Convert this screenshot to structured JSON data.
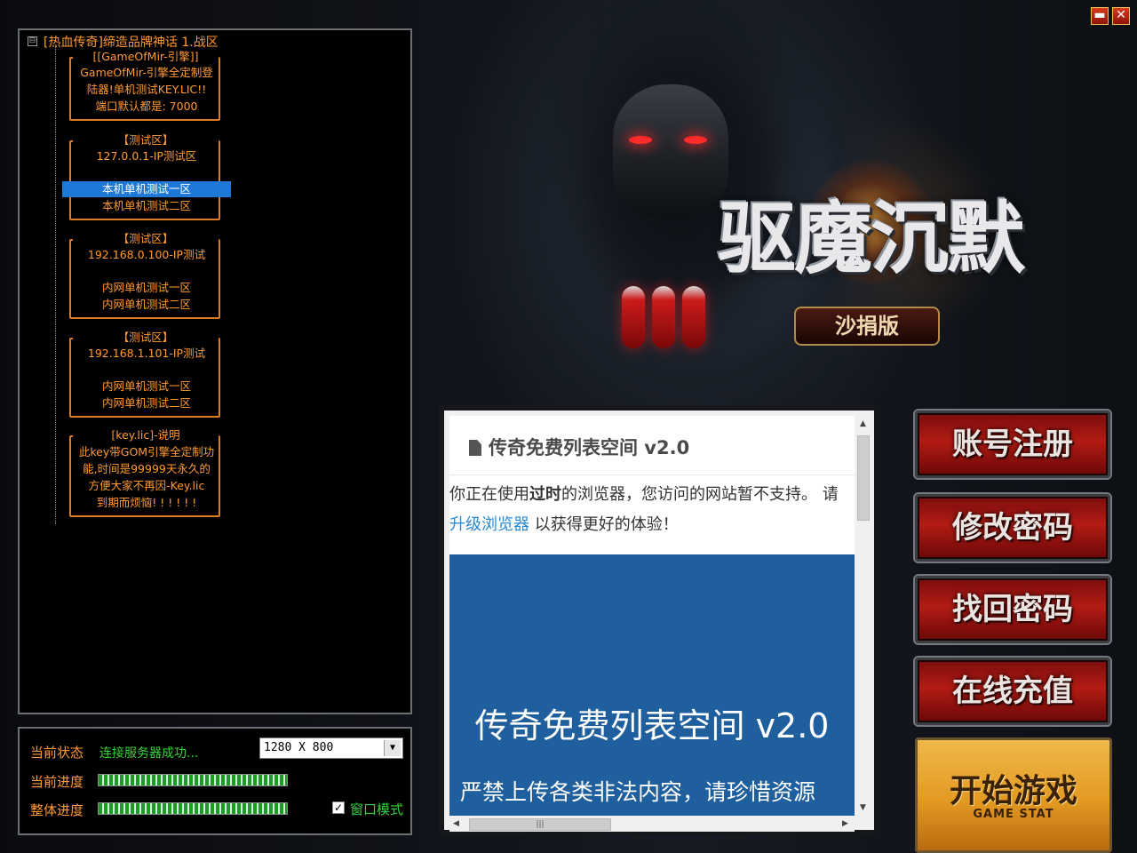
{
  "window": {
    "minimize_label": "▬",
    "close_label": "✕"
  },
  "logo": {
    "title": "驱魔沉默",
    "subtitle": "沙捐版"
  },
  "tree": {
    "expander": "⊟",
    "root_label": "[热血传奇]缔造品牌神话 1.战区",
    "groups": [
      {
        "title": "[[GameOfMir-引擎]]",
        "lines": [
          "GameOfMir-引擎全定制登",
          "陆器!单机测试KEY.LIC!!",
          "端口默认都是: 7000"
        ]
      },
      {
        "title": "【测试区】",
        "lines": [
          "127.0.0.1-IP测试区",
          "本机单机测试一区",
          "本机单机测试二区"
        ]
      },
      {
        "title": "【测试区】",
        "lines": [
          "192.168.0.100-IP测试",
          "内网单机测试一区",
          "内网单机测试二区"
        ]
      },
      {
        "title": "【测试区】",
        "lines": [
          "192.168.1.101-IP测试",
          "内网单机测试一区",
          "内网单机测试二区"
        ]
      },
      {
        "title": "[key.lic]-说明",
        "lines": [
          "此key带GOM引擎全定制功",
          "能,时间是99999天永久的",
          "方便大家不再因-Key.lic",
          "到期而烦恼! ! ! ! ! !"
        ]
      }
    ]
  },
  "status": {
    "state_label": "当前状态",
    "state_value": "连接服务器成功...",
    "current_progress_label": "当前进度",
    "current_progress": 1.0,
    "total_progress_label": "整体进度",
    "total_progress": 1.0,
    "resolution": "1280 X 800",
    "window_mode_label": "窗口模式",
    "window_mode_checked": true
  },
  "browser": {
    "header": "传奇免费列表空间 v2.0",
    "warn_prefix": "你正在使用",
    "warn_bold": "过时",
    "warn_mid": "的浏览器，您访问的网站暂不支持。 请",
    "warn_link": "升级浏览器",
    "warn_suffix": " 以获得更好的体验！",
    "banner_title": "传奇免费列表空间 v2.0",
    "banner_sub": "严禁上传各类非法内容，请珍惜资源"
  },
  "menu": {
    "register": "账号注册",
    "change_password": "修改密码",
    "recover_password": "找回密码",
    "recharge": "在线充值",
    "start": "开始游戏",
    "start_sub": "GAME STAT"
  },
  "colors": {
    "tree_text": "#ff9a30",
    "status_ok": "#34d23a",
    "selection": "#1e78d8",
    "menu_red": "#b31b14",
    "start_gold": "#e39a22"
  }
}
